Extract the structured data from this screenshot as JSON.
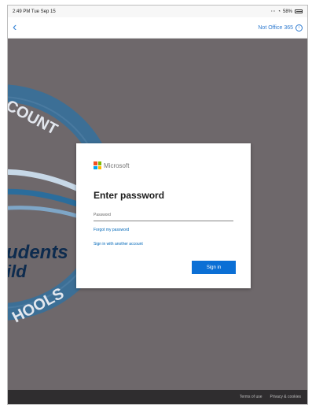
{
  "status_bar": {
    "time": "2:49 PM  Tue Sep 15",
    "battery_percent": "58%"
  },
  "nav": {
    "back_icon": "back-chevron-icon",
    "link": "Not Office 365",
    "info_icon": "info-icon"
  },
  "background": {
    "seal_text_top": "COUNT",
    "seal_text_bottom": "HOOLS",
    "seal_text_students": "udents",
    "seal_text_build": "ild"
  },
  "dialog": {
    "brand": "Microsoft",
    "title": "Enter password",
    "password_placeholder": "Password",
    "forgot_link": "Forgot my password",
    "other_account_link": "Sign in with another account",
    "sign_in_button": "Sign in"
  },
  "footer": {
    "terms": "Terms of use",
    "privacy": "Privacy & cookies"
  }
}
